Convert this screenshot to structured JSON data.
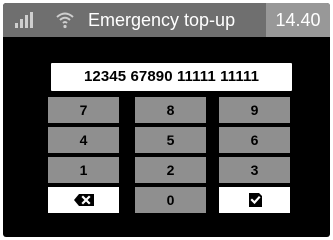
{
  "status_bar": {
    "title": "Emergency top-up",
    "time": "14.40",
    "icons": [
      "signal-icon",
      "wifi-icon"
    ]
  },
  "display": {
    "number": "12345 67890 11111 11111"
  },
  "keypad": {
    "keys": [
      {
        "label": "7"
      },
      {
        "label": "8"
      },
      {
        "label": "9"
      },
      {
        "label": "4"
      },
      {
        "label": "5"
      },
      {
        "label": "6"
      },
      {
        "label": "1"
      },
      {
        "label": "2"
      },
      {
        "label": "3"
      },
      {
        "label": "",
        "icon": "backspace-icon"
      },
      {
        "label": "0"
      },
      {
        "label": "",
        "icon": "confirm-check-icon"
      }
    ]
  },
  "colors": {
    "background": "#000000",
    "status_bar": "#6f6f6f",
    "time_box": "#989898",
    "key_gray": "#8f8f8f",
    "key_white": "#ffffff"
  }
}
